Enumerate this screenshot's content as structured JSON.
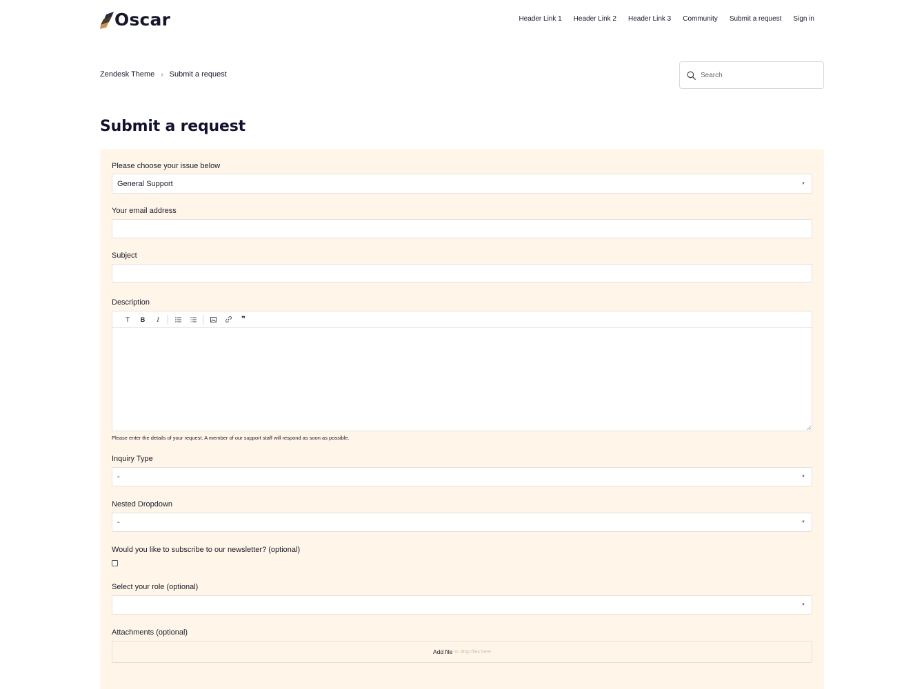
{
  "header": {
    "brand": "Oscar",
    "nav": [
      "Header Link 1",
      "Header Link 2",
      "Header Link 3",
      "Community",
      "Submit a request",
      "Sign in"
    ]
  },
  "breadcrumb": [
    "Zendesk Theme",
    "Submit a request"
  ],
  "search": {
    "placeholder": "Search"
  },
  "page_title": "Submit a request",
  "form": {
    "issue_label": "Please choose your issue below",
    "issue_value": "General Support",
    "email_label": "Your email address",
    "email_value": "",
    "subject_label": "Subject",
    "subject_value": "",
    "description_label": "Description",
    "toolbar": {
      "text_label": "T",
      "bold_label": "B",
      "italic_label": "I",
      "quote_label": "❞"
    },
    "description_hint": "Please enter the details of your request. A member of our support staff will respond as soon as possible.",
    "inquiry_label": "Inquiry Type",
    "inquiry_value": "-",
    "nested_label": "Nested Dropdown",
    "nested_value": "-",
    "newsletter_label": "Would you like to subscribe to our newsletter? (optional)",
    "newsletter_checked": false,
    "role_label": "Select your role (optional)",
    "role_value": "",
    "attachments_label": "Attachments (optional)",
    "add_file_label": "Add file",
    "drop_files_label": "or drop files here"
  },
  "colors": {
    "panel_bg": "#fff6e9",
    "title": "#121230",
    "logo_dark": "#2a2a3a",
    "logo_accent": "#c8935a"
  }
}
